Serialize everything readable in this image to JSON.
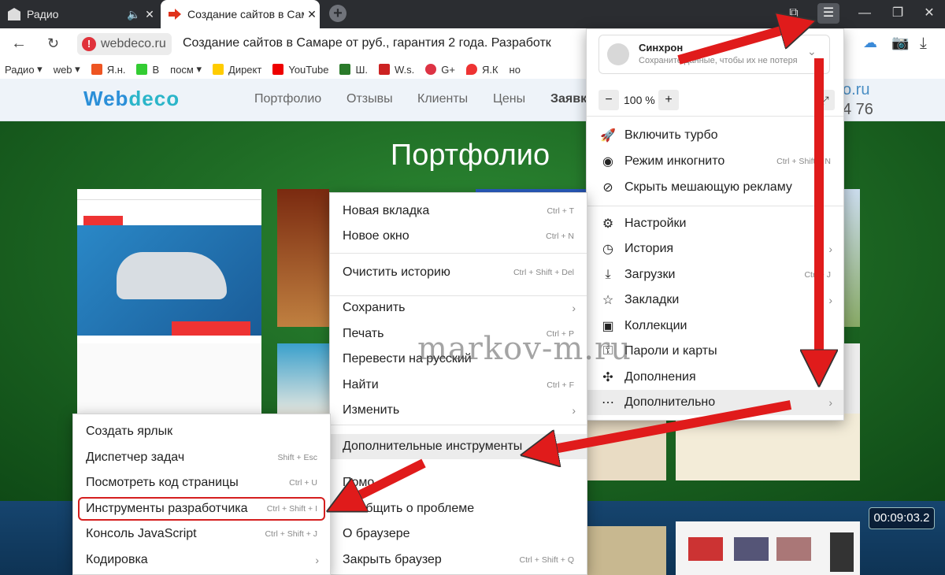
{
  "tabs": [
    {
      "label": "Радио",
      "muted_icon": "speaker-icon"
    },
    {
      "label": "Создание сайтов в Сам"
    }
  ],
  "url": {
    "domain": "webdeco.ru",
    "title": "Создание сайтов в Самаре от       руб., гарантия 2 года. Разработк"
  },
  "bookmarks": [
    "Радио",
    "web",
    "Я.н.",
    "В",
    "посм",
    "Директ",
    "YouTube",
    "Ш.",
    "W.s.",
    "G+",
    "Я.К",
    "но"
  ],
  "site": {
    "logo_a": "Web",
    "logo_b": "deco",
    "nav": [
      "Портфолио",
      "Отзывы",
      "Клиенты",
      "Цены",
      "Заявк"
    ],
    "phone_part": "4 76",
    "phone_top": "o.ru",
    "hero_title": "Портфолио"
  },
  "sync": {
    "title": "Синхрон",
    "subtitle": "Сохраните данные, чтобы их не потеря"
  },
  "zoom": {
    "minus": "−",
    "value": "100 %",
    "plus": "+"
  },
  "yandex_menu": [
    {
      "label": "Включить турбо",
      "icon": "rocket-icon"
    },
    {
      "label": "Режим инкогнито",
      "icon": "mask-icon",
      "shortcut": "Ctrl + Shift + N"
    },
    {
      "label": "Скрыть мешающую рекламу",
      "icon": "block-icon"
    },
    {
      "label": "Настройки",
      "icon": "gear-icon"
    },
    {
      "label": "История",
      "icon": "clock-icon"
    },
    {
      "label": "Загрузки",
      "icon": "download-icon",
      "shortcut": "Ctrl + J"
    },
    {
      "label": "Закладки",
      "icon": "star-icon"
    },
    {
      "label": "Коллекции",
      "icon": "collection-icon"
    },
    {
      "label": "Пароли и карты",
      "icon": "key-icon"
    },
    {
      "label": "Дополнения",
      "icon": "puzzle-icon"
    },
    {
      "label": "Дополнительно",
      "icon": "more-icon"
    }
  ],
  "more_menu": [
    {
      "label": "Новая вкладка",
      "shortcut": "Ctrl + T"
    },
    {
      "label": "Новое окно",
      "shortcut": "Ctrl + N"
    },
    {
      "label": "Очистить историю",
      "shortcut": "Ctrl + Shift + Del"
    },
    {
      "label": "Сохранить",
      "shortcut": ""
    },
    {
      "label": "Печать",
      "shortcut": "Ctrl + P"
    },
    {
      "label": "Перевести на русский",
      "shortcut": ""
    },
    {
      "label": "Найти",
      "shortcut": "Ctrl + F"
    },
    {
      "label": "Изменить",
      "shortcut": ""
    },
    {
      "label": "Дополнительные инструменты",
      "shortcut": ""
    },
    {
      "label": "Помо",
      "shortcut": ""
    },
    {
      "label": "Сообщить о проблеме",
      "shortcut": ""
    },
    {
      "label": "О браузере",
      "shortcut": ""
    },
    {
      "label": "Закрыть браузер",
      "shortcut": "Ctrl + Shift + Q"
    }
  ],
  "tools_menu": [
    {
      "label": "Создать ярлык",
      "shortcut": ""
    },
    {
      "label": "Диспетчер задач",
      "shortcut": "Shift + Esc"
    },
    {
      "label": "Посмотреть код страницы",
      "shortcut": "Ctrl + U"
    },
    {
      "label": "Инструменты разработчика",
      "shortcut": "Ctrl + Shift + I"
    },
    {
      "label": "Консоль JavaScript",
      "shortcut": "Ctrl + Shift + J"
    },
    {
      "label": "Кодировка",
      "shortcut": ""
    }
  ],
  "watermark": "markov-m.ru",
  "timer": "00:09:03.2",
  "colors": {
    "accent_red": "#e01b1b",
    "tabbar": "#2b2d31",
    "hero_green": "#1f6c25"
  }
}
